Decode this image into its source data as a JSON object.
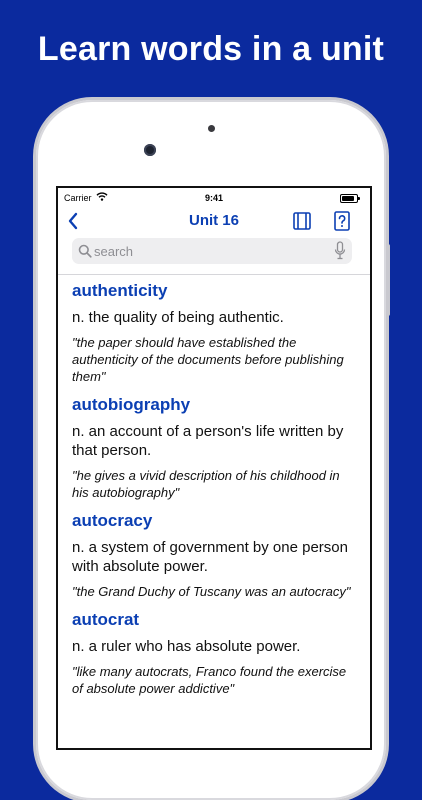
{
  "promo": {
    "headline": "Learn words in a unit"
  },
  "status_bar": {
    "carrier": "Carrier",
    "time": "9:41"
  },
  "nav": {
    "title": "Unit 16"
  },
  "search": {
    "placeholder": "search"
  },
  "entries": [
    {
      "word": "authenticity",
      "definition": "n. the quality of being authentic.",
      "example": "\"the paper should have established the authenticity of the documents before publishing them\""
    },
    {
      "word": "autobiography",
      "definition": "n. an account of a person's life written by that person.",
      "example": "\"he gives a vivid description of his childhood in his autobiography\""
    },
    {
      "word": "autocracy",
      "definition": "n. a system of government by one person with absolute power.",
      "example": "\"the Grand Duchy of Tuscany was an autocracy\""
    },
    {
      "word": "autocrat",
      "definition": "n. a ruler who has absolute power.",
      "example": "\"like many autocrats, Franco found the exercise of absolute power addictive\""
    }
  ],
  "colors": {
    "background": "#0b2a9e",
    "accent": "#0b3fb3"
  },
  "icons": [
    "wifi-icon",
    "battery-icon",
    "back-chevron-icon",
    "book-icon",
    "help-icon",
    "search-icon",
    "microphone-icon"
  ]
}
